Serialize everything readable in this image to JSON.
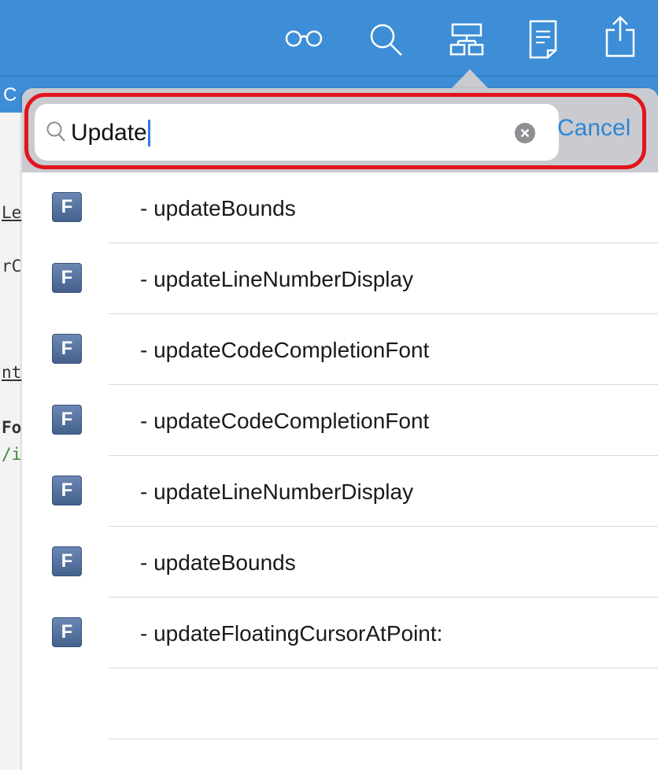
{
  "toolbar": {
    "icons": [
      "glasses-icon",
      "search-icon",
      "hierarchy-icon",
      "document-icon",
      "share-icon"
    ]
  },
  "editor": {
    "header_fragment": "C",
    "code_fragments": [
      "Le",
      "rC",
      "nt",
      "Fo",
      "/i"
    ]
  },
  "search": {
    "query": "Update",
    "cancel_label": "Cancel"
  },
  "results": {
    "badge": "F",
    "items": [
      "- updateBounds",
      "- updateLineNumberDisplay",
      "- updateCodeCompletionFont",
      "- updateCodeCompletionFont",
      "- updateLineNumberDisplay",
      "- updateBounds",
      "- updateFloatingCursorAtPoint:"
    ]
  },
  "colors": {
    "toolbar": "#3d8ed6",
    "accent": "#2f86d5",
    "highlight": "#e2141c",
    "badge": "#4f6b97"
  }
}
